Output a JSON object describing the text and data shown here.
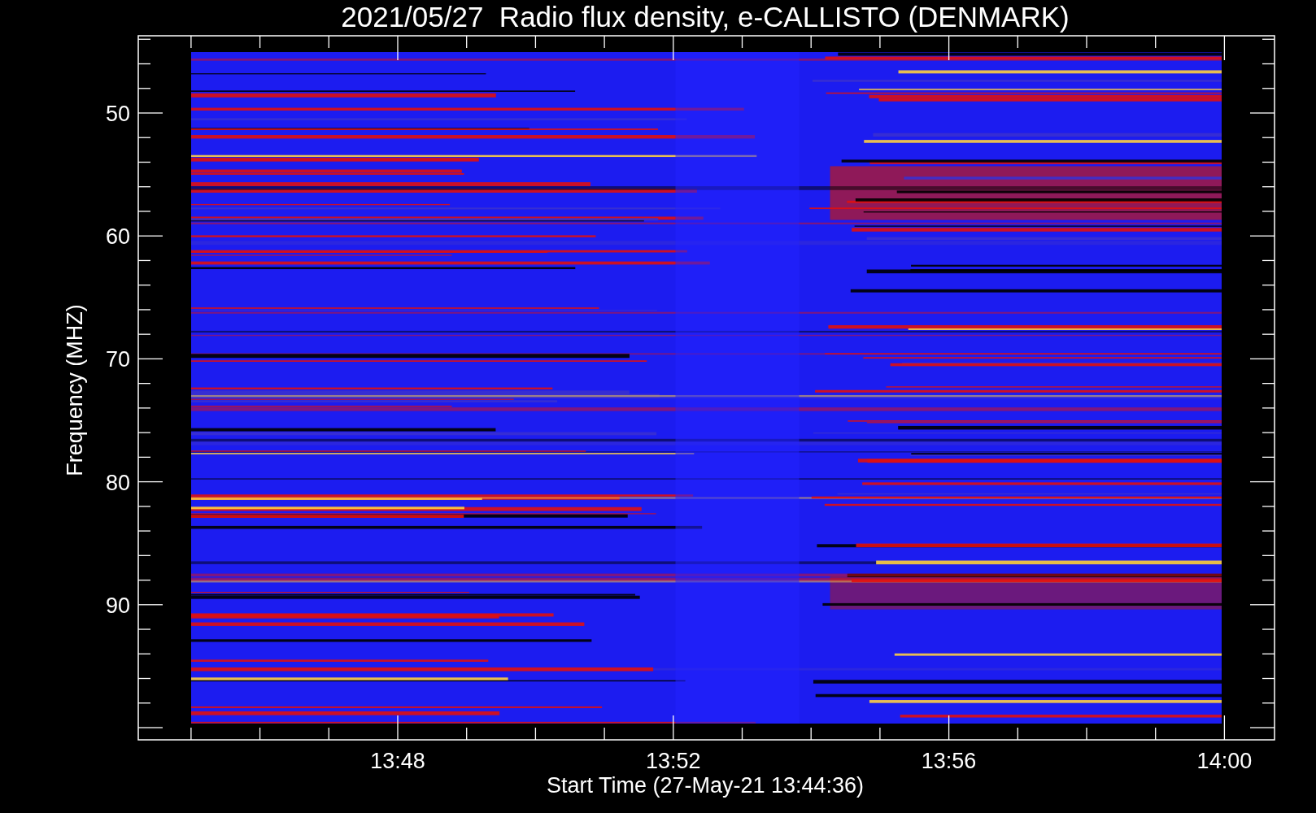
{
  "title": "2021/05/27  Radio flux density, e-CALLISTO (DENMARK)",
  "y_axis": {
    "label": "Frequency (MHZ)",
    "ticks": [
      "50",
      "60",
      "70",
      "80",
      "90"
    ]
  },
  "x_axis": {
    "label": "Start Time (27-May-21 13:44:36)",
    "ticks": [
      "13:48",
      "13:52",
      "13:56",
      "14:00"
    ]
  }
}
